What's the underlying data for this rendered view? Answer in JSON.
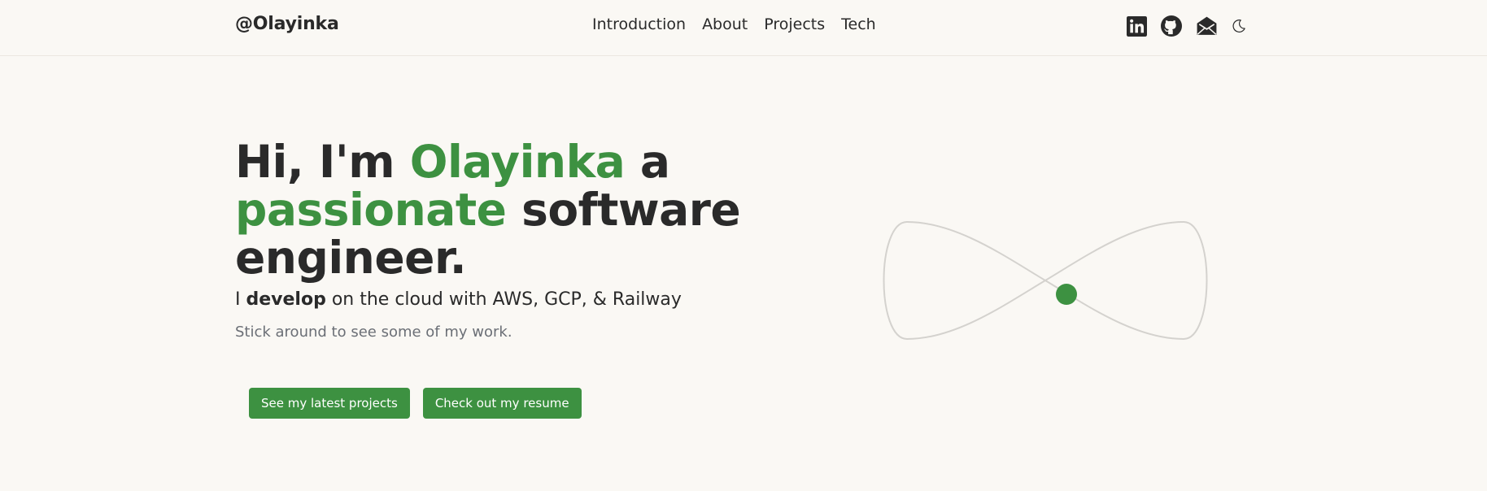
{
  "nav": {
    "brand": "@Olayinka",
    "links": [
      "Introduction",
      "About",
      "Projects",
      "Tech"
    ],
    "icons": [
      "linkedin-icon",
      "github-icon",
      "mail-icon",
      "moon-icon"
    ]
  },
  "hero": {
    "headline": {
      "part1": "Hi, I'm ",
      "name": "Olayinka",
      "part2": " a ",
      "adjective": "passionate",
      "part3": " software engineer."
    },
    "subline": {
      "prefix": "I ",
      "bold": "develop",
      "suffix": " on the cloud with AWS, GCP, & Railway"
    },
    "tagline": "Stick around to see some of my work.",
    "buttons": {
      "projects": "See my latest projects",
      "resume": "Check out my resume"
    }
  },
  "colors": {
    "accent": "#3d9141",
    "background": "#faf8f4",
    "text": "#2a2a2a",
    "muted": "#6b6f76",
    "loop_stroke": "#d4d2ce"
  }
}
